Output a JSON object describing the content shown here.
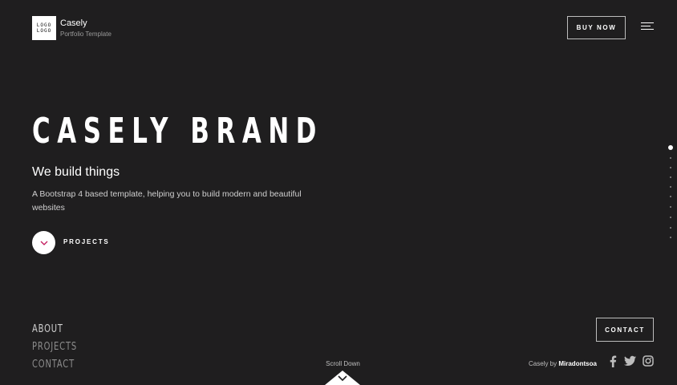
{
  "header": {
    "logo_line_1": "LOGO",
    "logo_line_2": "LOGO",
    "brand_name": "Casely",
    "brand_tagline": "Portfolio Template",
    "buy_button": "BUY NOW",
    "menu_icon": "hamburger-icon"
  },
  "hero": {
    "title": "CASELY BRAND",
    "subtitle": "We build things",
    "description": "A Bootstrap 4 based template, helping you to build modern and beautiful websites",
    "projects_label": "PROJECTS",
    "projects_icon": "chevron-down-icon"
  },
  "dot_nav": {
    "count": 10,
    "active_index": 0
  },
  "footer": {
    "nav": [
      "ABOUT",
      "PROJECTS",
      "CONTACT"
    ],
    "contact_button": "CONTACT",
    "scroll_label": "Scroll Down",
    "credit_prefix": "Casely by",
    "credit_author": "Miradontsoa",
    "social_icons": [
      "facebook-icon",
      "twitter-icon",
      "instagram-icon"
    ]
  },
  "colors": {
    "background": "#1f1e1f",
    "accent": "#c2185b",
    "text": "#ffffff"
  }
}
